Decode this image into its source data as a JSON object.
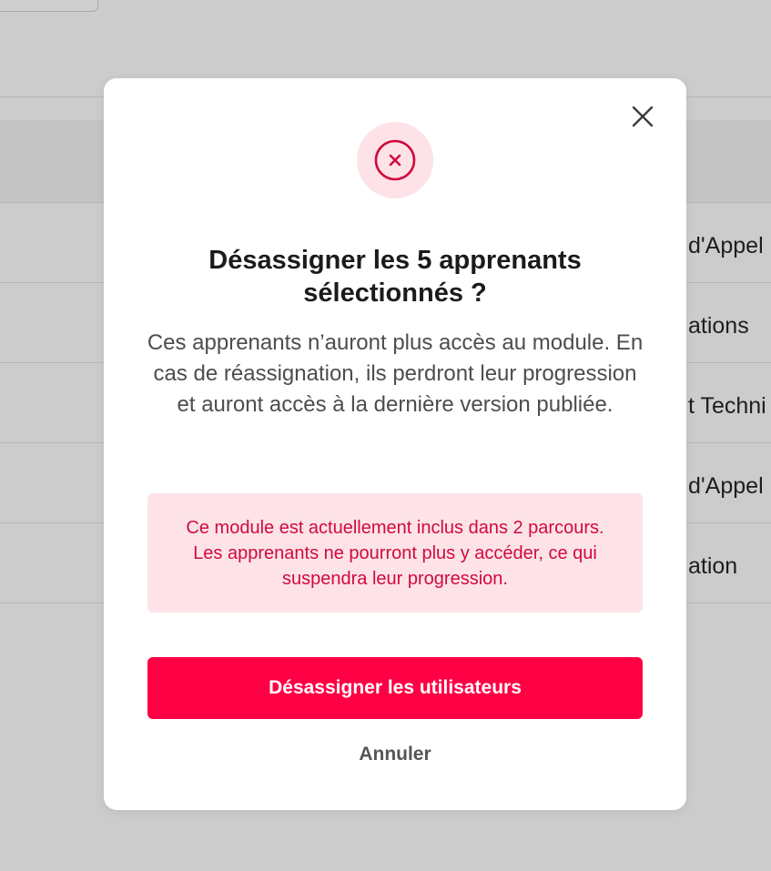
{
  "background": {
    "row_labels": [
      "d'Appel",
      "ations",
      "t Techni",
      "d'Appel",
      "ation"
    ]
  },
  "modal": {
    "status_icon": "error-x-circle-icon",
    "close_icon": "close-icon",
    "title": "Désassigner les 5 apprenants sélectionnés ?",
    "description": "Ces apprenants n’auront plus accès au module. En cas de réassignation, ils perdront leur progression et auront accès à la dernière version publiée.",
    "warning": "Ce module est actuellement inclus dans 2 parcours. Les apprenants ne pourront plus y accéder, ce qui suspendra leur progression.",
    "primary_button": "Désassigner les utilisateurs",
    "cancel_button": "Annuler"
  },
  "colors": {
    "accent": "#ff0044",
    "warning_bg": "#fde3e8",
    "warning_text": "#d10a3d",
    "overlay_bg": "#cccccc"
  }
}
